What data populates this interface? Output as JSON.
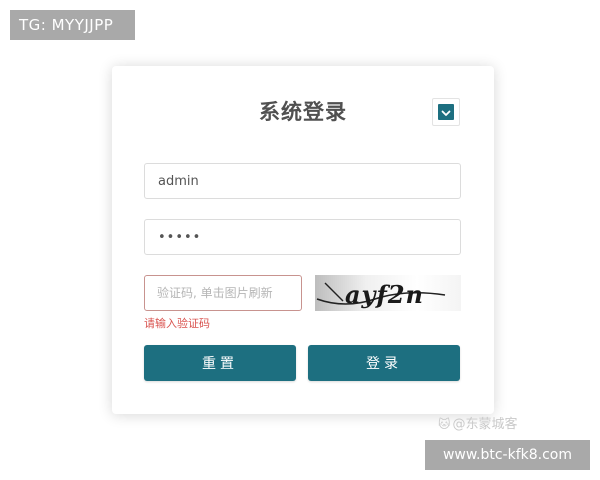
{
  "watermark": {
    "tg_label": "TG: MYYJJPP",
    "author": "@东蒙城客",
    "author_icon": "cat-icon",
    "url": "www.btc-kfk8.com"
  },
  "login": {
    "title": "系统登录",
    "lang_icon": "chevron-down-icon",
    "username_value": "admin",
    "password_value": "•••••",
    "captcha_placeholder": "验证码, 单击图片刷新",
    "captcha_text": "ayf2n",
    "captcha_error": "请输入验证码",
    "reset_label": "重置",
    "login_label": "登录"
  },
  "colors": {
    "primary": "#1d6f80",
    "error": "#d9534f",
    "watermark_bg": "#a9a9a9"
  }
}
